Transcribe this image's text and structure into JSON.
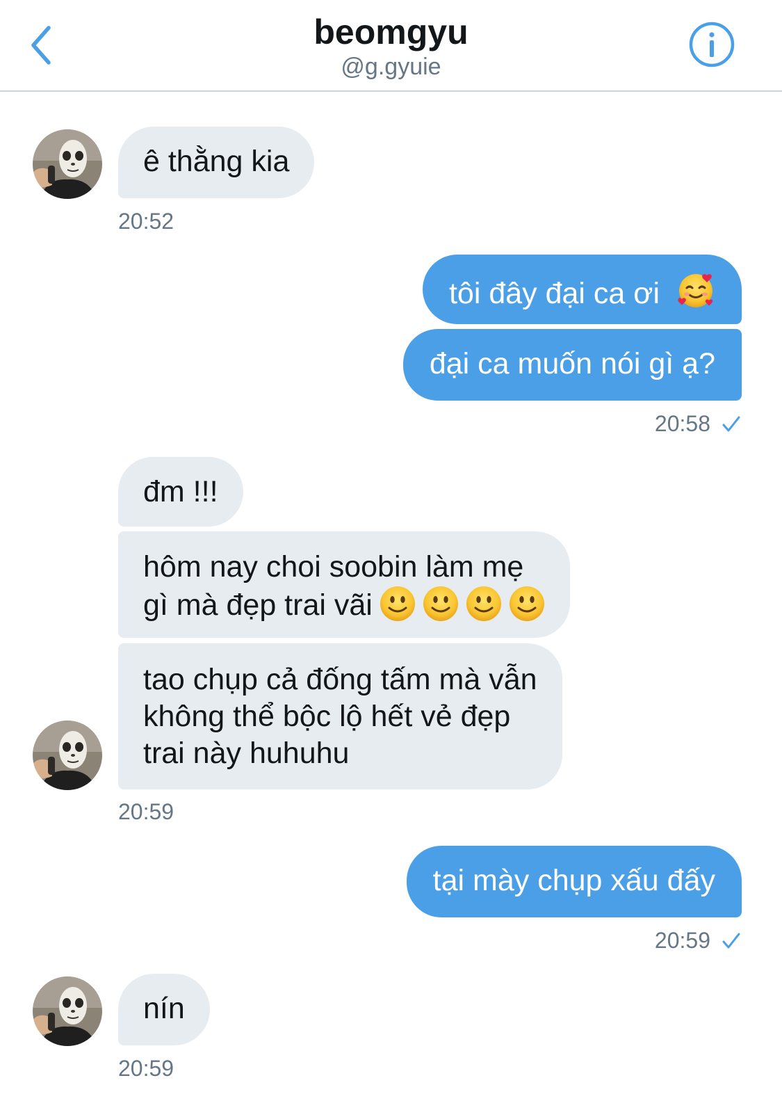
{
  "header": {
    "name": "beomgyu",
    "handle": "@g.gyuie",
    "back_icon": "chevron-left-icon",
    "info_icon": "info-circle-icon",
    "accent_color": "#4a9fe6"
  },
  "messages": [
    {
      "direction": "incoming",
      "text": "ê thằng kia",
      "timestamp": "20:52"
    },
    {
      "direction": "outgoing",
      "text": "tôi đây đại ca ơi",
      "emoji": "smiling-face-with-hearts-icon"
    },
    {
      "direction": "outgoing",
      "text": "đại ca muốn nói gì ạ?",
      "timestamp": "20:58",
      "status": "sent-check"
    },
    {
      "direction": "incoming",
      "text": "đm !!!"
    },
    {
      "direction": "incoming",
      "line1": "hôm nay choi soobin làm mẹ",
      "line2": "gì mà đẹp trai vãi",
      "emoji": "slightly-smiling-face-icon",
      "emoji_count": 4
    },
    {
      "direction": "incoming",
      "line1": "tao chụp cả đống tấm mà vẫn",
      "line2": "không thể bộc lộ hết vẻ đẹp",
      "line3": "trai này huhuhu",
      "timestamp": "20:59"
    },
    {
      "direction": "outgoing",
      "text": "tại mày chụp xấu đấy",
      "timestamp": "20:59",
      "status": "sent-check"
    },
    {
      "direction": "incoming",
      "text": "nín",
      "timestamp": "20:59"
    }
  ],
  "colors": {
    "incoming_bubble": "#e6ecf0",
    "outgoing_bubble": "#4a9fe6",
    "timestamp": "#657786"
  }
}
